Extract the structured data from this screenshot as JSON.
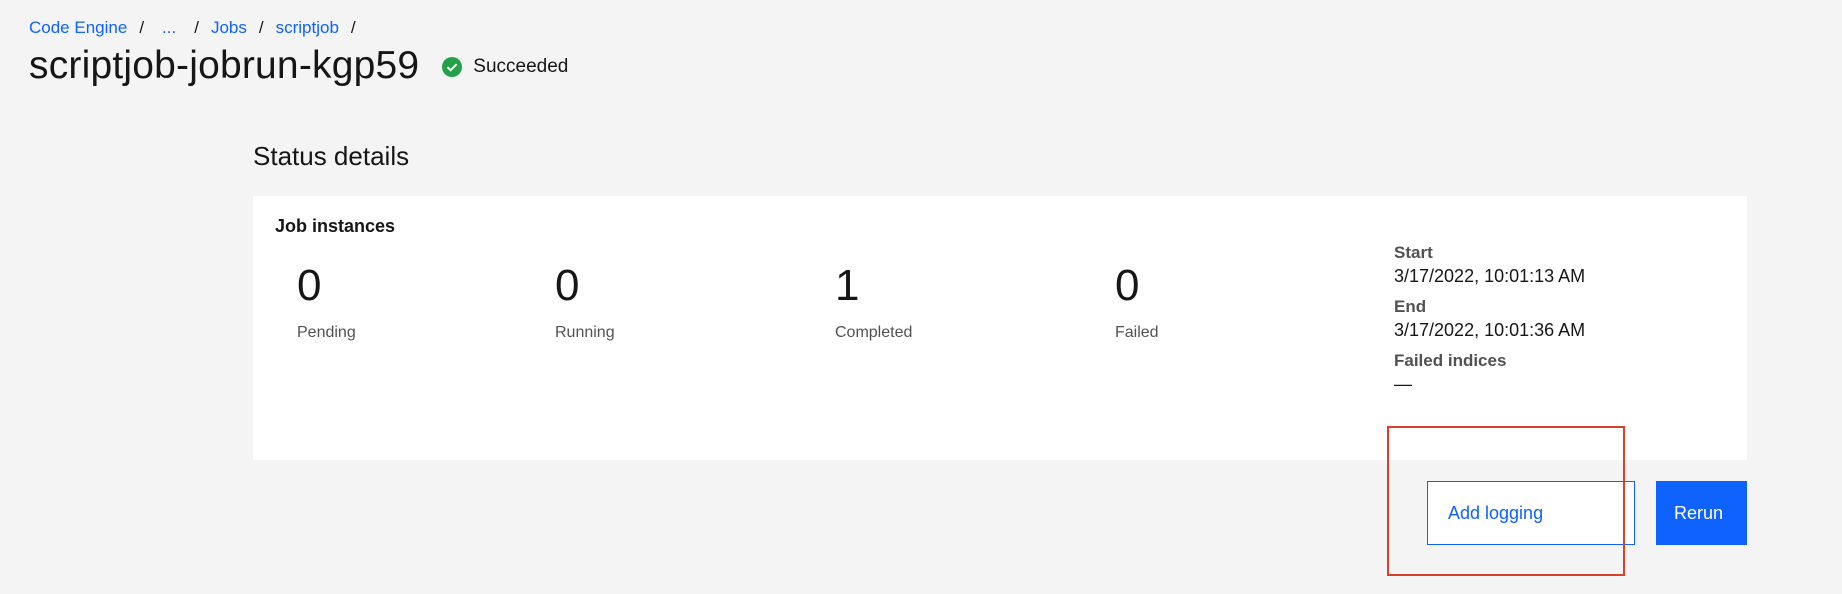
{
  "breadcrumb": {
    "items": [
      {
        "label": "Code Engine"
      },
      {
        "label": "..."
      },
      {
        "label": "Jobs"
      },
      {
        "label": "scriptjob"
      }
    ],
    "separator": "/"
  },
  "header": {
    "title": "scriptjob-jobrun-kgp59",
    "status": {
      "label": "Succeeded",
      "icon": "checkmark-filled-icon",
      "color": "#24a148"
    }
  },
  "status_details": {
    "section_title": "Status details",
    "card_heading": "Job instances",
    "metrics": [
      {
        "value": "0",
        "label": "Pending"
      },
      {
        "value": "0",
        "label": "Running"
      },
      {
        "value": "1",
        "label": "Completed"
      },
      {
        "value": "0",
        "label": "Failed"
      }
    ],
    "details": {
      "start_label": "Start",
      "start_value": "3/17/2022, 10:01:13 AM",
      "end_label": "End",
      "end_value": "3/17/2022, 10:01:36 AM",
      "failed_indices_label": "Failed indices",
      "failed_indices_value": "—"
    }
  },
  "actions": {
    "add_logging_label": "Add logging",
    "rerun_label": "Rerun"
  },
  "colors": {
    "accent": "#0f62fe",
    "background": "#f4f4f4",
    "annotation": "#d8402a"
  }
}
